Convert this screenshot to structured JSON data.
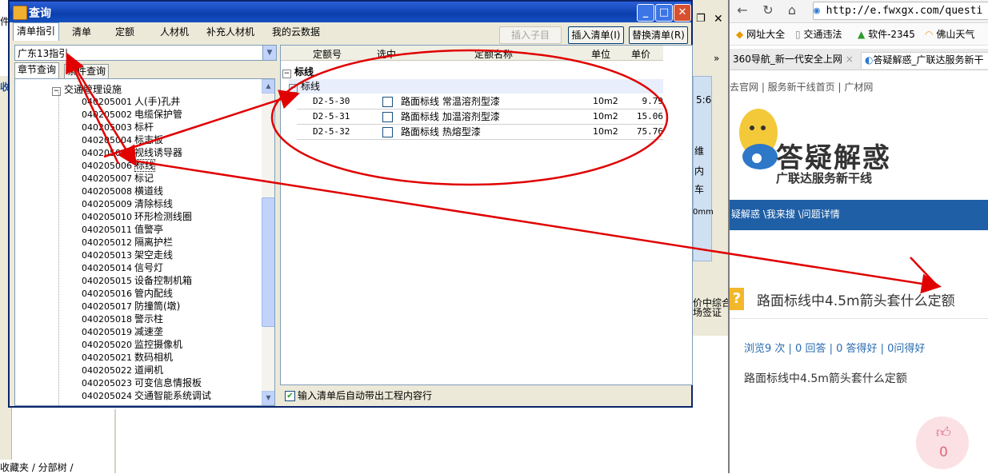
{
  "background": {
    "bottom_tabs": "收藏夹 / 分部树 /",
    "behind_labels": [
      "5:6",
      "维",
      "内",
      "车",
      "0mm",
      "价中综合",
      "场签证"
    ],
    "behind_left_labels": [
      "收",
      "件"
    ]
  },
  "browser": {
    "url": "http://e.fwxgx.com/questi",
    "bookmarks": [
      "网址大全",
      "交通违法",
      "软件-2345",
      "佛山天气"
    ],
    "tabs": [
      "360导航_新一代安全上网",
      "答疑解惑_广联达服务新干"
    ],
    "links": "去官网  |  服务新干线首页  |  广材网",
    "logo_title": "答疑解惑",
    "logo_subtitle": "广联达服务新干线",
    "breadcrumb": "疑解惑 \\我来搜 \\问题详情",
    "question_title": "路面标线中4.5m箭头套什么定额",
    "question_stats": "浏览9 次 | 0 回答 | 0 答得好 | 0问得好",
    "question_body": "路面标线中4.5m箭头套什么定额",
    "like_count": "0"
  },
  "dialog": {
    "title": "查询",
    "menu_tabs": [
      "清单指引",
      "清单",
      "定额",
      "人材机",
      "补充人材机",
      "我的云数据"
    ],
    "buttons": {
      "insert_child": "插入子目",
      "insert_list": "插入清单(I)",
      "replace_list": "替换清单(R)"
    },
    "combo_value": "广东13指引",
    "sub_tabs": [
      "章节查询",
      "条件查询"
    ],
    "tree_root": "交通管理设施",
    "tree_items": [
      {
        "code": "040205001",
        "name": "人(手)孔井"
      },
      {
        "code": "040205002",
        "name": "电缆保护管"
      },
      {
        "code": "040205003",
        "name": "标杆"
      },
      {
        "code": "040205004",
        "name": "标志板"
      },
      {
        "code": "040205005",
        "name": "视线诱导器"
      },
      {
        "code": "040205006",
        "name": "标线"
      },
      {
        "code": "040205007",
        "name": "标记"
      },
      {
        "code": "040205008",
        "name": "横道线"
      },
      {
        "code": "040205009",
        "name": "清除标线"
      },
      {
        "code": "040205010",
        "name": "环形检测线圈"
      },
      {
        "code": "040205011",
        "name": "值警亭"
      },
      {
        "code": "040205012",
        "name": "隔离护栏"
      },
      {
        "code": "040205013",
        "name": "架空走线"
      },
      {
        "code": "040205014",
        "name": "信号灯"
      },
      {
        "code": "040205015",
        "name": "设备控制机箱"
      },
      {
        "code": "040205016",
        "name": "管内配线"
      },
      {
        "code": "040205017",
        "name": "防撞筒(墩)"
      },
      {
        "code": "040205018",
        "name": "警示柱"
      },
      {
        "code": "040205019",
        "name": "减速垄"
      },
      {
        "code": "040205020",
        "name": "监控摄像机"
      },
      {
        "code": "040205021",
        "name": "数码相机"
      },
      {
        "code": "040205022",
        "name": "道闸机"
      },
      {
        "code": "040205023",
        "name": "可变信息情报板"
      },
      {
        "code": "040205024",
        "name": "交通智能系统调试"
      }
    ],
    "grid_headers": [
      "定额号",
      "选中",
      "定额名称",
      "单位",
      "单价"
    ],
    "group_main": "标线",
    "group_sub": "标线",
    "rows": [
      {
        "code": "D2-5-30",
        "name": "路面标线 常温溶剂型漆",
        "unit": "10m2",
        "price": "9.79"
      },
      {
        "code": "D2-5-31",
        "name": "路面标线 加温溶剂型漆",
        "unit": "10m2",
        "price": "15.06"
      },
      {
        "code": "D2-5-32",
        "name": "路面标线 热熔型漆",
        "unit": "10m2",
        "price": "75.76"
      }
    ],
    "auto_bring": "输入清单后自动带出工程内容行"
  }
}
